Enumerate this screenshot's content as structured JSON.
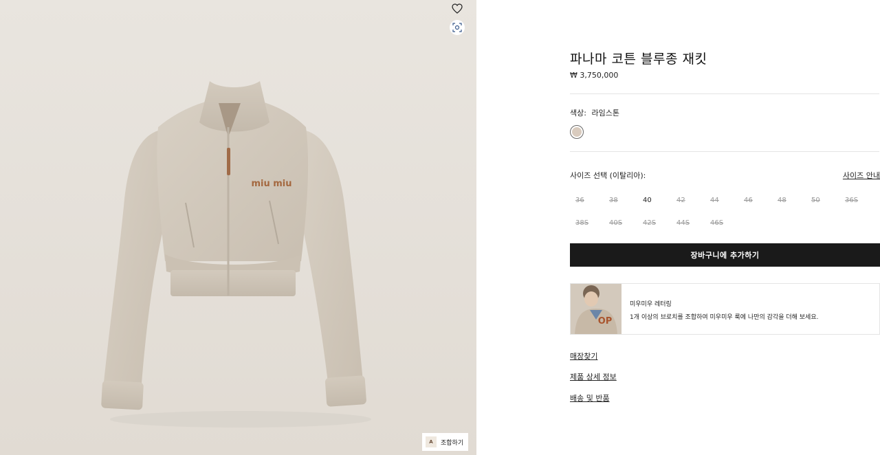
{
  "product": {
    "title": "파나마 코튼 블루종 재킷",
    "price": "₩ 3,750,000",
    "chest_logo_text": "miu miu",
    "color_label": "색상:",
    "color_value": "라임스톤",
    "swatch_color": "#d9cbbe"
  },
  "image_overlay": {
    "wishlist_icon": "heart-outline-icon",
    "zoom_icon": "zoom-scan-icon",
    "combine_label": "조합하기",
    "combine_thumb_text": "A"
  },
  "sizes": {
    "label": "사이즈 선택 (이탈리아):",
    "guide_label": "사이즈 안내",
    "options": [
      {
        "label": "36",
        "available": false
      },
      {
        "label": "38",
        "available": false
      },
      {
        "label": "40",
        "available": true
      },
      {
        "label": "42",
        "available": false
      },
      {
        "label": "44",
        "available": false
      },
      {
        "label": "46",
        "available": false
      },
      {
        "label": "48",
        "available": false
      },
      {
        "label": "50",
        "available": false
      },
      {
        "label": "36S",
        "available": false
      },
      {
        "label": "38S",
        "available": false
      },
      {
        "label": "40S",
        "available": false
      },
      {
        "label": "42S",
        "available": false
      },
      {
        "label": "44S",
        "available": false
      },
      {
        "label": "46S",
        "available": false
      }
    ]
  },
  "actions": {
    "add_to_cart": "장바구니에 추가하기"
  },
  "promo": {
    "title": "미우미우 레터링",
    "description": "1개 이상의 브로치를 조합하여 미우미우 룩에 나만의 감각을 더해 보세요.",
    "image_text": "OP"
  },
  "links": [
    {
      "label": "매장찾기"
    },
    {
      "label": "제품 상세 정보"
    },
    {
      "label": "배송 및 반품"
    }
  ]
}
